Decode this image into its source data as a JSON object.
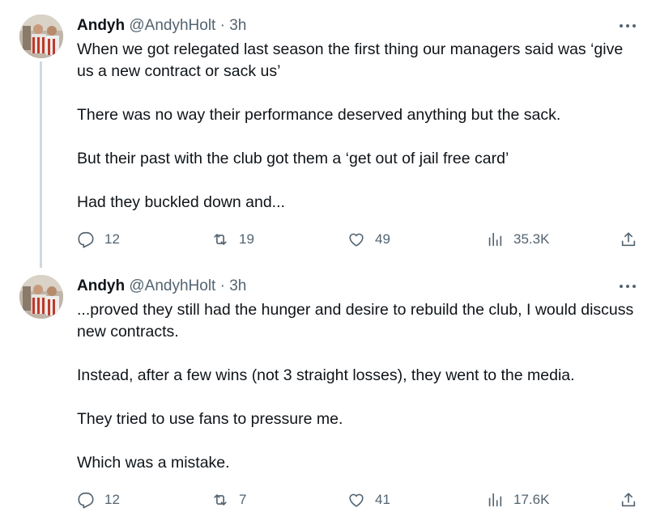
{
  "tweets": [
    {
      "name": "Andyh",
      "handle": "@AndyhHolt",
      "separator": "·",
      "time": "3h",
      "paragraphs": [
        "When we got relegated last season the first thing our managers said was ‘give us a new contract or sack us’",
        "There was no way their performance deserved anything but the sack.",
        "But their past with the club got them a ‘get out of jail free card’",
        "Had they buckled down and..."
      ],
      "replies": "12",
      "retweets": "19",
      "likes": "49",
      "views": "35.3K"
    },
    {
      "name": "Andyh",
      "handle": "@AndyhHolt",
      "separator": "·",
      "time": "3h",
      "paragraphs": [
        "...proved they still had the hunger and desire to rebuild the club, I would discuss new contracts.",
        "Instead, after a few wins (not 3 straight losses), they went to the media.",
        "They tried to use fans to pressure me.",
        "Which was a mistake."
      ],
      "replies": "12",
      "retweets": "7",
      "likes": "41",
      "views": "17.6K"
    }
  ],
  "icons": {
    "reply": "reply-icon",
    "retweet": "retweet-icon",
    "like": "heart-icon",
    "views": "views-icon",
    "share": "share-icon",
    "more": "more-icon"
  },
  "colors": {
    "text": "#0f1419",
    "secondary": "#536471",
    "thread_line": "#cfd9de"
  }
}
